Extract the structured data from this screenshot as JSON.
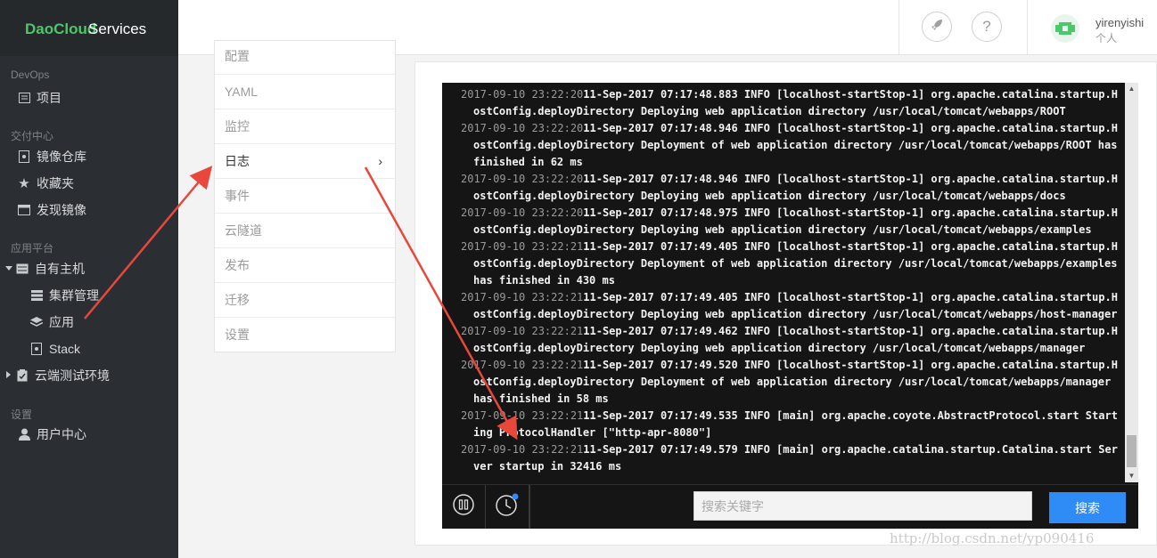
{
  "app": {
    "brand": "DaoCloud",
    "brand_suffix": "Services"
  },
  "sidebar": {
    "sections": [
      {
        "title": "DevOps"
      },
      {
        "title": "交付中心"
      },
      {
        "title": "应用平台"
      },
      {
        "title": "设置"
      }
    ],
    "items": {
      "projects": "项目",
      "image_repo": "镜像仓库",
      "favorites": "收藏夹",
      "discover": "发现镜像",
      "own_host": "自有主机",
      "cluster": "集群管理",
      "apps": "应用",
      "stack": "Stack",
      "cloud_test": "云端测试环境",
      "user_center": "用户中心"
    }
  },
  "header": {
    "username": "yirenyishi",
    "user_type": "个人"
  },
  "submenu": {
    "items": [
      {
        "label": "配置"
      },
      {
        "label": "YAML"
      },
      {
        "label": "监控"
      },
      {
        "label": "日志",
        "active": true
      },
      {
        "label": "事件"
      },
      {
        "label": "云隧道"
      },
      {
        "label": "发布"
      },
      {
        "label": "迁移"
      },
      {
        "label": "设置"
      }
    ],
    "chevron": "›"
  },
  "logs": [
    {
      "ts": "2017-09-10 23:22:20",
      "msg": "11-Sep-2017 07:17:48.883 INFO [localhost-startStop-1] org.apache.catalina.startup.HostConfig.deployDirectory Deploying web application directory /usr/local/tomcat/webapps/ROOT"
    },
    {
      "ts": "2017-09-10 23:22:20",
      "msg": "11-Sep-2017 07:17:48.946 INFO [localhost-startStop-1] org.apache.catalina.startup.HostConfig.deployDirectory Deployment of web application directory /usr/local/tomcat/webapps/ROOT has finished in 62 ms"
    },
    {
      "ts": "2017-09-10 23:22:20",
      "msg": "11-Sep-2017 07:17:48.946 INFO [localhost-startStop-1] org.apache.catalina.startup.HostConfig.deployDirectory Deploying web application directory /usr/local/tomcat/webapps/docs"
    },
    {
      "ts": "2017-09-10 23:22:20",
      "msg": "11-Sep-2017 07:17:48.975 INFO [localhost-startStop-1] org.apache.catalina.startup.HostConfig.deployDirectory Deploying web application directory /usr/local/tomcat/webapps/examples"
    },
    {
      "ts": "2017-09-10 23:22:21",
      "msg": "11-Sep-2017 07:17:49.405 INFO [localhost-startStop-1] org.apache.catalina.startup.HostConfig.deployDirectory Deployment of web application directory /usr/local/tomcat/webapps/examples has finished in 430 ms"
    },
    {
      "ts": "2017-09-10 23:22:21",
      "msg": "11-Sep-2017 07:17:49.405 INFO [localhost-startStop-1] org.apache.catalina.startup.HostConfig.deployDirectory Deploying web application directory /usr/local/tomcat/webapps/host-manager"
    },
    {
      "ts": "2017-09-10 23:22:21",
      "msg": "11-Sep-2017 07:17:49.462 INFO [localhost-startStop-1] org.apache.catalina.startup.HostConfig.deployDirectory Deploying web application directory /usr/local/tomcat/webapps/manager"
    },
    {
      "ts": "2017-09-10 23:22:21",
      "msg": "11-Sep-2017 07:17:49.520 INFO [localhost-startStop-1] org.apache.catalina.startup.HostConfig.deployDirectory Deployment of web application directory /usr/local/tomcat/webapps/manager has finished in 58 ms"
    },
    {
      "ts": "2017-09-10 23:22:21",
      "msg": "11-Sep-2017 07:17:49.535 INFO [main] org.apache.coyote.AbstractProtocol.start Starting ProtocolHandler [\"http-apr-8080\"]"
    },
    {
      "ts": "2017-09-10 23:22:21",
      "msg": "11-Sep-2017 07:17:49.579 INFO [main] org.apache.catalina.startup.Catalina.start Server startup in 32416 ms"
    }
  ],
  "search": {
    "placeholder": "搜索关键字",
    "button": "搜索"
  },
  "watermark": "http://blog.csdn.net/yp090416",
  "colors": {
    "brand_green": "#4cc76b",
    "sidebar_bg": "#2b2f33",
    "console_bg": "#151515",
    "primary_blue": "#2f8bf5",
    "arrow_red": "#e8483b"
  },
  "icons": {
    "header": [
      "rocket-icon",
      "help-icon"
    ],
    "toolbar": [
      "pause-icon",
      "history-clock-icon"
    ]
  }
}
